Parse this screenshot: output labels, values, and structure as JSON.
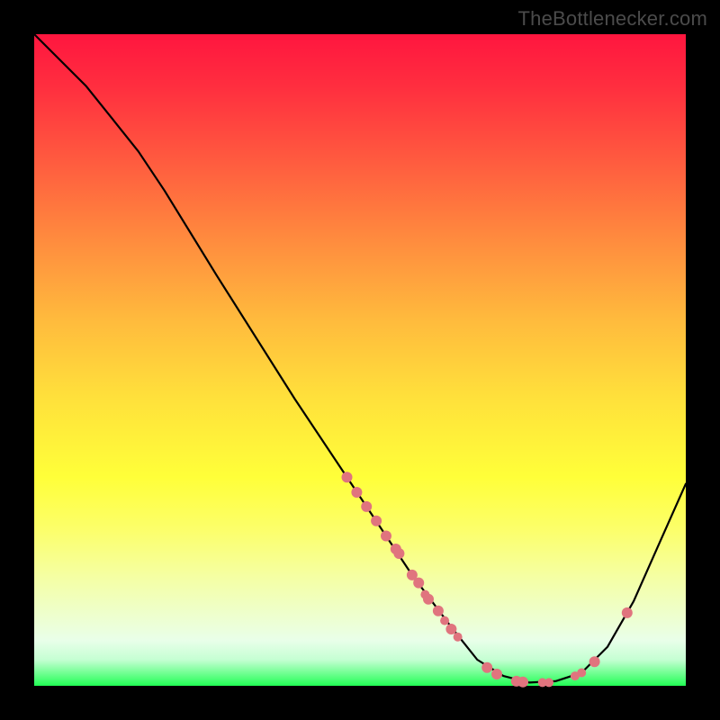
{
  "watermark": "TheBottlenecker.com",
  "colors": {
    "point": "#e0747e",
    "curve": "#000000",
    "background_top": "#ff163f",
    "background_bottom": "#22ff55"
  },
  "chart_data": {
    "type": "line",
    "title": "",
    "xlabel": "",
    "ylabel": "",
    "xlim": [
      0,
      100
    ],
    "ylim": [
      0,
      100
    ],
    "curve": [
      {
        "x": 0,
        "y": 100
      },
      {
        "x": 4,
        "y": 96
      },
      {
        "x": 8,
        "y": 92
      },
      {
        "x": 12,
        "y": 87
      },
      {
        "x": 16,
        "y": 82
      },
      {
        "x": 20,
        "y": 76
      },
      {
        "x": 28,
        "y": 63
      },
      {
        "x": 40,
        "y": 44
      },
      {
        "x": 50,
        "y": 29
      },
      {
        "x": 58,
        "y": 17
      },
      {
        "x": 64,
        "y": 9
      },
      {
        "x": 68,
        "y": 4
      },
      {
        "x": 72,
        "y": 1.5
      },
      {
        "x": 76,
        "y": 0.5
      },
      {
        "x": 80,
        "y": 0.7
      },
      {
        "x": 84,
        "y": 2
      },
      {
        "x": 88,
        "y": 6
      },
      {
        "x": 92,
        "y": 13
      },
      {
        "x": 96,
        "y": 22
      },
      {
        "x": 100,
        "y": 31
      }
    ],
    "points": [
      {
        "x": 48,
        "y": 32,
        "r": 6
      },
      {
        "x": 49.5,
        "y": 29.7,
        "r": 6
      },
      {
        "x": 51,
        "y": 27.5,
        "r": 6
      },
      {
        "x": 52.5,
        "y": 25.3,
        "r": 6
      },
      {
        "x": 54,
        "y": 23,
        "r": 6
      },
      {
        "x": 55.5,
        "y": 21,
        "r": 6
      },
      {
        "x": 56,
        "y": 20.3,
        "r": 6
      },
      {
        "x": 58,
        "y": 17,
        "r": 6
      },
      {
        "x": 59,
        "y": 15.8,
        "r": 6
      },
      {
        "x": 60,
        "y": 14,
        "r": 5
      },
      {
        "x": 60.5,
        "y": 13.3,
        "r": 6
      },
      {
        "x": 62,
        "y": 11.5,
        "r": 6
      },
      {
        "x": 63,
        "y": 10,
        "r": 5
      },
      {
        "x": 64,
        "y": 8.7,
        "r": 6
      },
      {
        "x": 65,
        "y": 7.5,
        "r": 5
      },
      {
        "x": 69.5,
        "y": 2.8,
        "r": 6
      },
      {
        "x": 71,
        "y": 1.8,
        "r": 6
      },
      {
        "x": 74,
        "y": 0.7,
        "r": 6
      },
      {
        "x": 75,
        "y": 0.6,
        "r": 6
      },
      {
        "x": 78,
        "y": 0.5,
        "r": 5
      },
      {
        "x": 79,
        "y": 0.5,
        "r": 5
      },
      {
        "x": 83,
        "y": 1.5,
        "r": 5
      },
      {
        "x": 84,
        "y": 2,
        "r": 5
      },
      {
        "x": 86,
        "y": 3.7,
        "r": 6
      },
      {
        "x": 91,
        "y": 11.2,
        "r": 6
      }
    ]
  }
}
